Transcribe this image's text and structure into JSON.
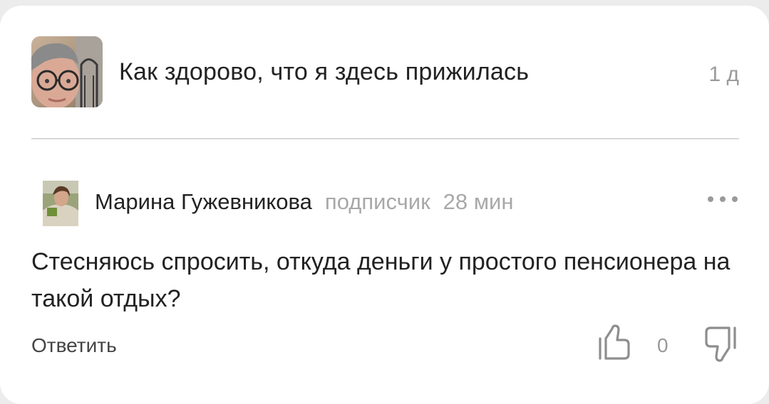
{
  "top_comment": {
    "text": "Как здорово, что я здесь прижилась",
    "time": "1 д",
    "avatar_icon": "user-photo-avatar"
  },
  "comment": {
    "author": "Марина Гужевникова",
    "role": "подписчик",
    "time": "28 мин",
    "avatar_icon": "user-photo-avatar",
    "more_icon": "more-dots-icon",
    "text": "Стесняюсь спросить, откуда деньги у простого пенсионера на такой отдых?",
    "reply_label": "Ответить",
    "like_icon": "thumbs-up-icon",
    "dislike_icon": "thumbs-down-icon",
    "rating": "0"
  },
  "colors": {
    "background": "#ececec",
    "card": "#ffffff",
    "text_primary": "#222222",
    "text_secondary": "#a8a8a8",
    "icon": "#8e8e8e"
  }
}
